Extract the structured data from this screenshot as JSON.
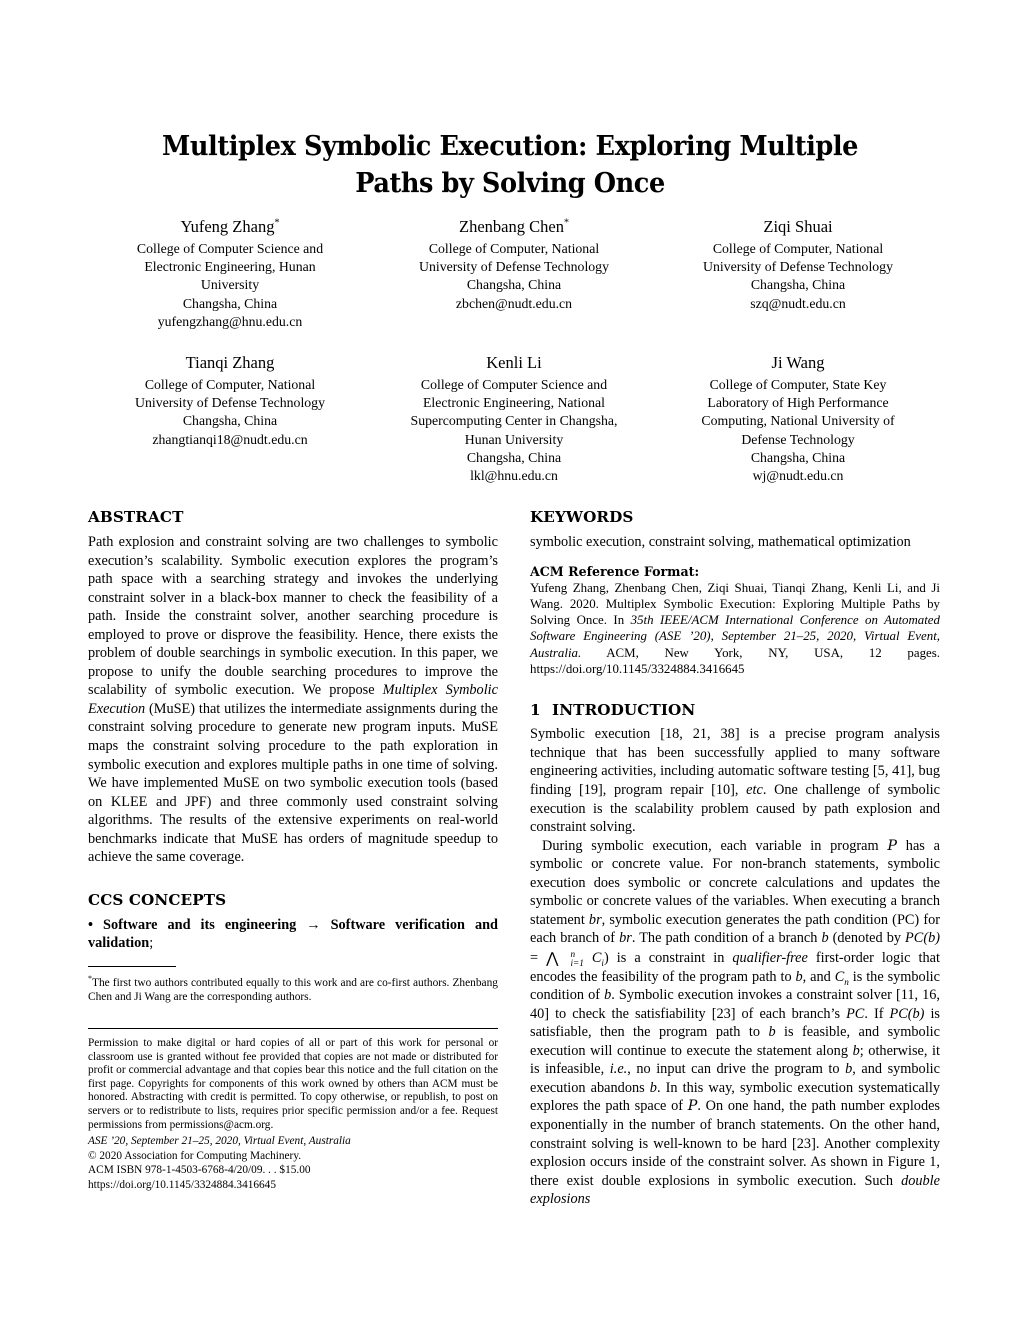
{
  "paper": {
    "title": "Multiplex Symbolic Execution: Exploring Multiple Paths by Solving Once",
    "authors_row1": [
      {
        "name": "Yufeng Zhang",
        "marker": "*",
        "affiliation": [
          "College of Computer Science and",
          "Electronic Engineering, Hunan",
          "University",
          "Changsha, China"
        ],
        "email": "yufengzhang@hnu.edu.cn"
      },
      {
        "name": "Zhenbang Chen",
        "marker": "*",
        "affiliation": [
          "College of Computer, National",
          "University of Defense Technology",
          "Changsha, China"
        ],
        "email": "zbchen@nudt.edu.cn"
      },
      {
        "name": "Ziqi Shuai",
        "marker": "",
        "affiliation": [
          "College of Computer, National",
          "University of Defense Technology",
          "Changsha, China"
        ],
        "email": "szq@nudt.edu.cn"
      }
    ],
    "authors_row2": [
      {
        "name": "Tianqi Zhang",
        "marker": "",
        "affiliation": [
          "College of Computer, National",
          "University of Defense Technology",
          "Changsha, China"
        ],
        "email": "zhangtianqi18@nudt.edu.cn"
      },
      {
        "name": "Kenli Li",
        "marker": "",
        "affiliation": [
          "College of Computer Science and",
          "Electronic Engineering, National",
          "Supercomputing Center in Changsha,",
          "Hunan University",
          "Changsha, China"
        ],
        "email": "lkl@hnu.edu.cn"
      },
      {
        "name": "Ji Wang",
        "marker": "",
        "affiliation": [
          "College of Computer, State Key",
          "Laboratory of High Performance",
          "Computing, National University of",
          "Defense Technology",
          "Changsha, China"
        ],
        "email": "wj@nudt.edu.cn"
      }
    ],
    "abstract": {
      "heading": "ABSTRACT",
      "part1": "Path explosion and constraint solving are two challenges to symbolic execution’s scalability. Symbolic execution explores the program’s path space with a searching strategy and invokes the underlying constraint solver in a black-box manner to check the feasibility of a path. Inside the constraint solver, another searching procedure is employed to prove or disprove the feasibility. Hence, there exists the problem of double searchings in symbolic execution. In this paper, we propose to unify the double searching procedures to improve the scalability of symbolic execution. We propose ",
      "italic1": "Multiplex Symbolic Execution",
      "part2": " (MuSE) that utilizes the intermediate assignments during the constraint solving procedure to generate new program inputs. MuSE maps the constraint solving procedure to the path exploration in symbolic execution and explores multiple paths in one time of solving. We have implemented MuSE on two symbolic execution tools (based on KLEE and JPF) and three commonly used constraint solving algorithms. The results of the extensive experiments on real-world benchmarks indicate that MuSE has orders of magnitude speedup to achieve the same coverage."
    },
    "ccs": {
      "heading": "CCS CONCEPTS",
      "bullet": "• ",
      "bold1": "Software and its engineering",
      "arrow": " → ",
      "bold2": "Software verification and validation",
      "tail": ";"
    },
    "keywords": {
      "heading": "KEYWORDS",
      "text": "symbolic execution, constraint solving, mathematical optimization"
    },
    "acm_reference": {
      "label": "ACM Reference Format:",
      "part1": "Yufeng Zhang, Zhenbang Chen, Ziqi Shuai, Tianqi Zhang, Kenli Li, and Ji Wang. 2020. Multiplex Symbolic Execution: Exploring Multiple Paths by Solving Once. In ",
      "italic1": "35th IEEE/ACM International Conference on Automated Software Engineering (ASE ’20), September 21–25, 2020, Virtual Event, Australia.",
      "part2": " ACM, New York, NY, USA, 12 pages. https://doi.org/10.1145/3324884.3416645"
    },
    "introduction": {
      "number": "1",
      "heading": "INTRODUCTION",
      "para1": "Symbolic execution [18, 21, 38] is a precise program analysis technique that has been successfully applied to many software engineering activities, including automatic software testing [5, 41], bug finding [19], program repair [10], ",
      "para1_italic": "etc",
      "para1_tail": ". One challenge of symbolic execution is the scalability problem caused by path explosion and constraint solving.",
      "para2_a": "During symbolic execution, each variable in program ",
      "para2_P1": "P",
      "para2_b": " has a symbolic or concrete value. For non-branch statements, symbolic execution does symbolic or concrete calculations and updates the symbolic or concrete values of the variables. When executing a branch statement ",
      "para2_br": "br",
      "para2_c": ", symbolic execution generates the path condition (PC) for each branch of ",
      "para2_br2": "br",
      "para2_d": ". The path condition of a branch ",
      "para2_b1": "b",
      "para2_e": " (denoted by ",
      "para2_pc": "PC(b)",
      "para2_eq": " = ",
      "para2_wedge": "⋀",
      "para2_wedge_sup": "n",
      "para2_wedge_sub": "i=1",
      "para2_ci": "C",
      "para2_ci_sub": "i",
      "para2_f": ") is a constraint in ",
      "para2_qf": "qualifier-free",
      "para2_g": " first-order logic that encodes the feasibility of the program path to ",
      "para2_b2": "b",
      "para2_h": ", and ",
      "para2_cn": "C",
      "para2_cn_sub": "n",
      "para2_i": " is the symbolic condition of ",
      "para2_b3": "b",
      "para2_j": ". Symbolic execution invokes a constraint solver [11, 16, 40] to check the satisfiability [23] of each branch’s ",
      "para2_pc2": "PC",
      "para2_k": ". If ",
      "para2_pc3": "PC(b)",
      "para2_l": " is satisfiable, then the program path to ",
      "para2_b4": "b",
      "para2_m": " is feasible, and symbolic execution will continue to execute the statement along ",
      "para2_b5": "b",
      "para2_n": "; otherwise, it is infeasible, ",
      "para2_ie": "i.e.",
      "para2_o": ", no input can drive the program to ",
      "para2_b6": "b",
      "para2_p": ", and symbolic execution abandons ",
      "para2_b7": "b",
      "para2_q": ". In this way, symbolic execution systematically explores the path space of ",
      "para2_P2": "P",
      "para2_r": ". On one hand, the path number explodes exponentially in the number of branch statements. On the other hand, constraint solving is well-known to be hard [23]. Another complexity explosion occurs inside of the constraint solver. As shown in Figure 1, there exist double explosions in symbolic execution. Such ",
      "para2_de": "double explosions"
    },
    "footnote": {
      "marker": "*",
      "text": "The first two authors contributed equally to this work and are co-first authors. Zhenbang Chen and Ji Wang are the corresponding authors."
    },
    "copyright": {
      "permission": "Permission to make digital or hard copies of all or part of this work for personal or classroom use is granted without fee provided that copies are not made or distributed for profit or commercial advantage and that copies bear this notice and the full citation on the first page. Copyrights for components of this work owned by others than ACM must be honored. Abstracting with credit is permitted. To copy otherwise, or republish, to post on servers or to redistribute to lists, requires prior specific permission and/or a fee. Request permissions from permissions@acm.org.",
      "venue": "ASE ’20, September 21–25, 2020, Virtual Event, Australia",
      "copyline": "© 2020 Association for Computing Machinery.",
      "isbn": "ACM ISBN 978-1-4503-6768-4/20/09. . . $15.00",
      "doi": "https://doi.org/10.1145/3324884.3416645"
    }
  }
}
